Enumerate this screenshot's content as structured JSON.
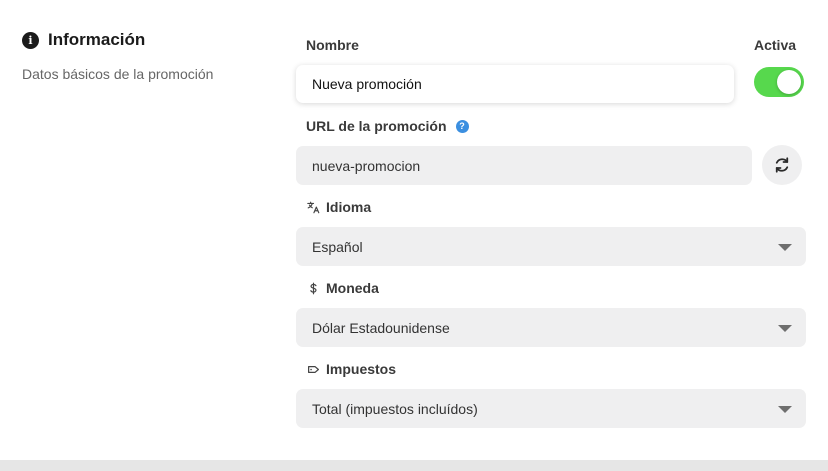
{
  "section": {
    "icon": "info-icon",
    "title": "Información",
    "description": "Datos básicos de la promoción"
  },
  "fields": {
    "name": {
      "label": "Nombre",
      "value": "Nueva promoción"
    },
    "active": {
      "label": "Activa",
      "checked": true,
      "color": "#57d84d"
    },
    "url": {
      "label": "URL de la promoción",
      "help_icon": "help-icon",
      "value": "nueva-promocion",
      "regenerate_icon": "refresh-icon"
    },
    "language": {
      "label": "Idioma",
      "icon": "translate-icon",
      "selected": "Español"
    },
    "currency": {
      "label": "Moneda",
      "icon": "dollar-icon",
      "selected": "Dólar Estadounidense"
    },
    "taxes": {
      "label": "Impuestos",
      "icon": "tag-icon",
      "selected": "Total (impuestos incluídos)"
    }
  }
}
